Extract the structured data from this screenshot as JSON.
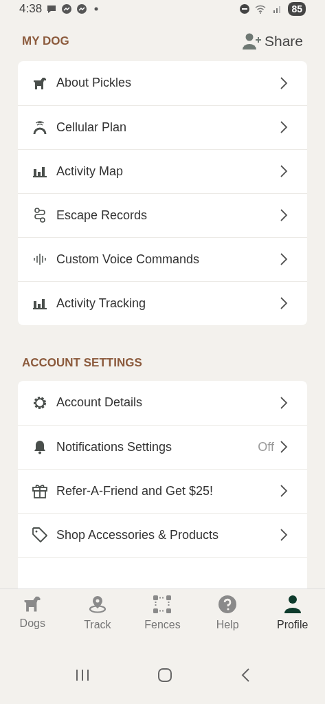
{
  "status_bar": {
    "time": "4:38",
    "battery": "85"
  },
  "my_dog": {
    "title": "MY DOG",
    "share_label": "Share",
    "items": [
      {
        "label": "About Pickles"
      },
      {
        "label": "Cellular Plan"
      },
      {
        "label": "Activity Map"
      },
      {
        "label": "Escape Records"
      },
      {
        "label": "Custom Voice Commands"
      },
      {
        "label": "Activity Tracking"
      }
    ]
  },
  "account_settings": {
    "title": "ACCOUNT SETTINGS",
    "items": [
      {
        "label": "Account Details"
      },
      {
        "label": "Notifications Settings",
        "value": "Off"
      },
      {
        "label": "Refer-A-Friend and Get $25!"
      },
      {
        "label": "Shop Accessories & Products"
      }
    ]
  },
  "bottom_nav": [
    {
      "label": "Dogs",
      "selected": false
    },
    {
      "label": "Track",
      "selected": false
    },
    {
      "label": "Fences",
      "selected": false
    },
    {
      "label": "Help",
      "selected": false
    },
    {
      "label": "Profile",
      "selected": true
    }
  ]
}
